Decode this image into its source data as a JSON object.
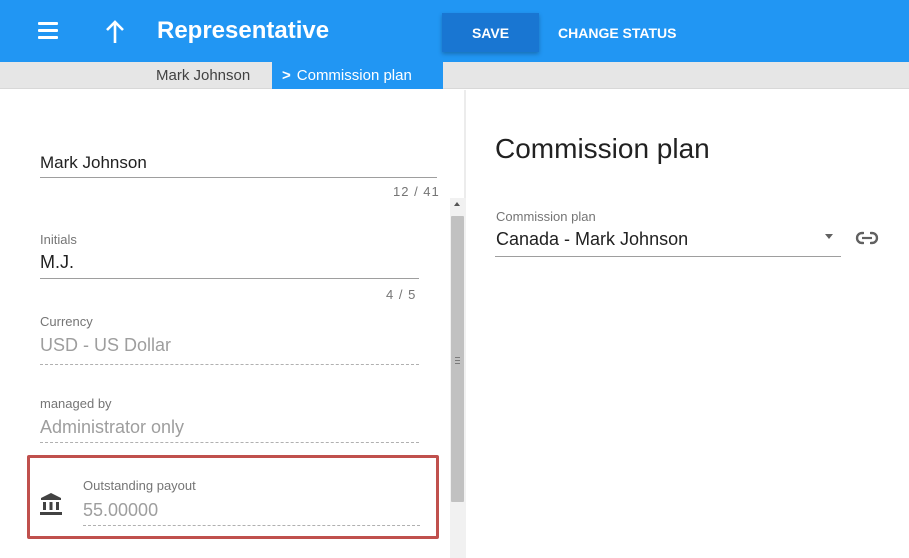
{
  "appbar": {
    "title": "Representative",
    "save_label": "SAVE",
    "change_status_label": "CHANGE STATUS",
    "menu_icon": "hamburger-menu-icon",
    "up_icon": "arrow-up-icon",
    "color": "#2196f3"
  },
  "breadcrumb": {
    "parent": "Mark Johnson",
    "current": "Commission plan"
  },
  "form": {
    "name": {
      "value": "Mark Johnson",
      "counter": "12 / 41"
    },
    "initials": {
      "label": "Initials",
      "value": "M.J.",
      "counter": "4 / 5"
    },
    "currency": {
      "label": "Currency",
      "value": "USD - US Dollar"
    },
    "managed_by": {
      "label": "managed by",
      "value": "Administrator only"
    },
    "outstanding_payout": {
      "label": "Outstanding payout",
      "value": "55.00000",
      "icon": "bank-icon"
    }
  },
  "commission": {
    "title": "Commission plan",
    "select_label": "Commission plan",
    "select_value": "Canada - Mark Johnson",
    "link_icon": "link-icon"
  },
  "colors": {
    "highlight_border": "#c0504d",
    "primary_dark": "#1976d2"
  }
}
